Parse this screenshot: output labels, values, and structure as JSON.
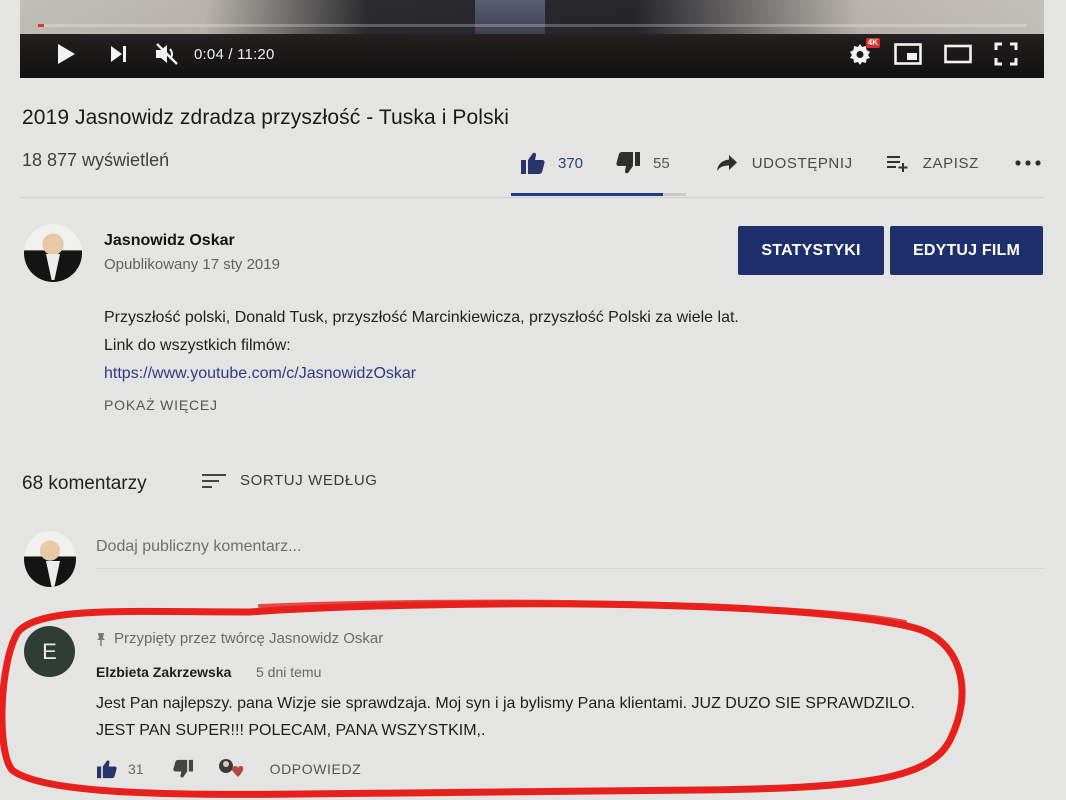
{
  "player": {
    "time_display": "0:04 / 11:20",
    "progress_fraction": 0.006,
    "quality_badge": "4K",
    "icons": [
      "play-icon",
      "next-icon",
      "mute-icon",
      "settings-icon",
      "miniplayer-icon",
      "theater-icon",
      "fullscreen-icon"
    ]
  },
  "video": {
    "title": "2019 Jasnowidz zdradza przyszłość - Tuska i Polski",
    "views": "18 877 wyświetleń",
    "likes": "370",
    "dislikes": "55",
    "share_label": "UDOSTĘPNIJ",
    "save_label": "ZAPISZ",
    "like_fraction": 0.87
  },
  "channel": {
    "name": "Jasnowidz Oskar",
    "published": "Opublikowany 17 sty 2019",
    "stats_button": "STATYSTYKI",
    "edit_button": "EDYTUJ FILM"
  },
  "description": {
    "line1": "Przyszłość polski, Donald Tusk, przyszłość Marcinkiewicza, przyszłość Polski za wiele lat.",
    "line2": "Link do wszystkich filmów:",
    "link": "https://www.youtube.com/c/JasnowidzOskar",
    "show_more": "POKAŻ WIĘCEJ"
  },
  "comments": {
    "count": "68 komentarzy",
    "sort_label": "SORTUJ WEDŁUG",
    "add_placeholder": "Dodaj publiczny komentarz...",
    "items": [
      {
        "avatar_letter": "E",
        "pinned": "Przypięty przez twórcę Jasnowidz Oskar",
        "author": "Elzbieta Zakrzewska",
        "time": "5 dni temu",
        "text": "Jest Pan najlepszy. pana Wizje sie sprawdzaja. Moj syn i ja bylismy Pana klientami. JUZ DUZO SIE SPRAWDZILO. JEST PAN SUPER!!! POLECAM, PANA WSZYSTKIM,.",
        "likes": "31",
        "reply_label": "ODPOWIEDZ"
      }
    ]
  },
  "colors": {
    "accent_blue": "#1f2f6b",
    "like_blue": "#27356a",
    "progress_red": "#e3332a",
    "annotation_red": "#e8201c",
    "background": "#e4e4e2"
  }
}
